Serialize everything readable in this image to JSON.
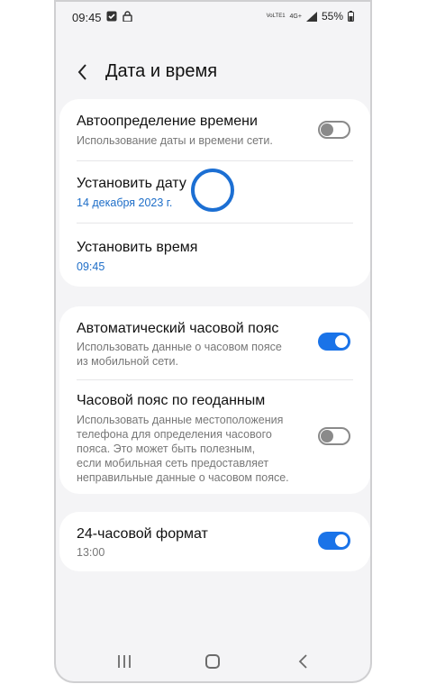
{
  "status_bar": {
    "time": "09:45",
    "network": "4G+",
    "volte": "VoLTE1",
    "battery": "55%"
  },
  "header": {
    "title": "Дата и время"
  },
  "card1": {
    "auto_time": {
      "title": "Автоопределение времени",
      "subtitle": "Использование даты и времени сети.",
      "toggle": "off"
    },
    "set_date": {
      "title": "Установить дату",
      "value": "14 декабря 2023 г."
    },
    "set_time": {
      "title": "Установить время",
      "value": "09:45"
    }
  },
  "card2": {
    "auto_tz": {
      "title": "Автоматический часовой пояс",
      "subtitle_line1": "Использовать данные о часовом поясе",
      "subtitle_line2": "из мобильной сети.",
      "toggle": "on"
    },
    "geo_tz": {
      "title": "Часовой пояс по геоданным",
      "subtitle_line1": "Использовать данные местоположения",
      "subtitle_line2": "телефона для определения часового",
      "subtitle_line3": "пояса. Это может быть полезным,",
      "subtitle_line4": "если мобильная сеть предоставляет",
      "subtitle_line5": "неправильные данные о часовом поясе.",
      "toggle": "off"
    }
  },
  "card3": {
    "format24": {
      "title": "24-часовой формат",
      "subtitle": "13:00",
      "toggle": "on"
    }
  },
  "colors": {
    "accent": "#1a73e8",
    "link_blue": "#1e6ec8",
    "background": "#f4f4f6"
  }
}
